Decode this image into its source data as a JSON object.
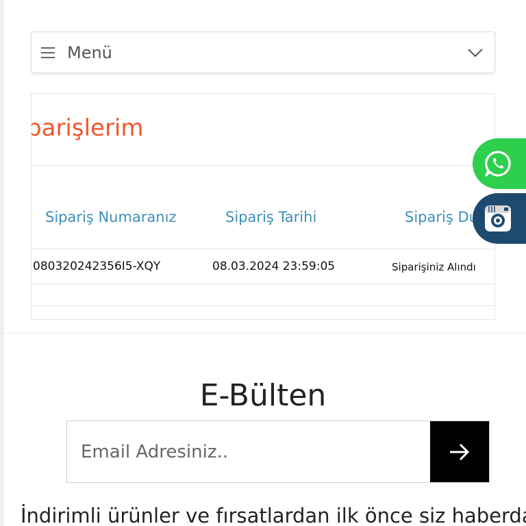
{
  "menu": {
    "label": "Menü"
  },
  "orders": {
    "title": "Siparişlerim",
    "columns": [
      "Sipariş Numaranız",
      "Sipariş Tarihi",
      "Sipariş Durumu"
    ],
    "rows": [
      {
        "number": "080320242356I5-XQY",
        "date": "08.03.2024 23:59:05",
        "status": "Siparişiniz Alındı"
      }
    ]
  },
  "contact": {
    "whatsapp_icon": "whatsapp-icon",
    "instagram_icon": "instagram-icon",
    "whatsapp_color": "#2fcf4e",
    "instagram_color": "#1f4a6f"
  },
  "newsletter": {
    "title": "E-Bülten",
    "email_placeholder": "Email Adresiniz..",
    "email_value": "",
    "submit_icon": "arrow-right-icon",
    "promo_text": "İndirimli ürünler ve fırsatlardan ilk önce siz haberdar"
  },
  "colors": {
    "accent": "#f2552c",
    "link": "#3d8fb8"
  }
}
